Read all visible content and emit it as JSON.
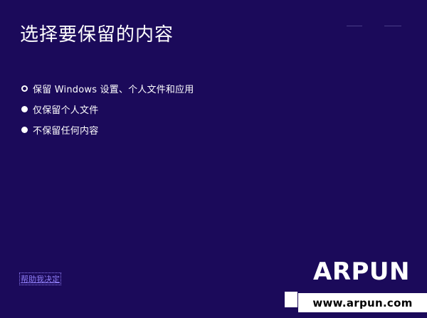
{
  "header": {
    "title": "选择要保留的内容"
  },
  "options": [
    {
      "label": "保留 Windows 设置、个人文件和应用",
      "selected": true
    },
    {
      "label": "仅保留个人文件",
      "selected": false
    },
    {
      "label": "不保留任何内容",
      "selected": false
    }
  ],
  "footer": {
    "help_link": "帮助我决定"
  },
  "watermark": {
    "logo": "ARPUN",
    "url": "www.arpun.com"
  },
  "colors": {
    "background": "#1b0a5a",
    "text": "#ffffff",
    "link": "#8f7df5"
  }
}
